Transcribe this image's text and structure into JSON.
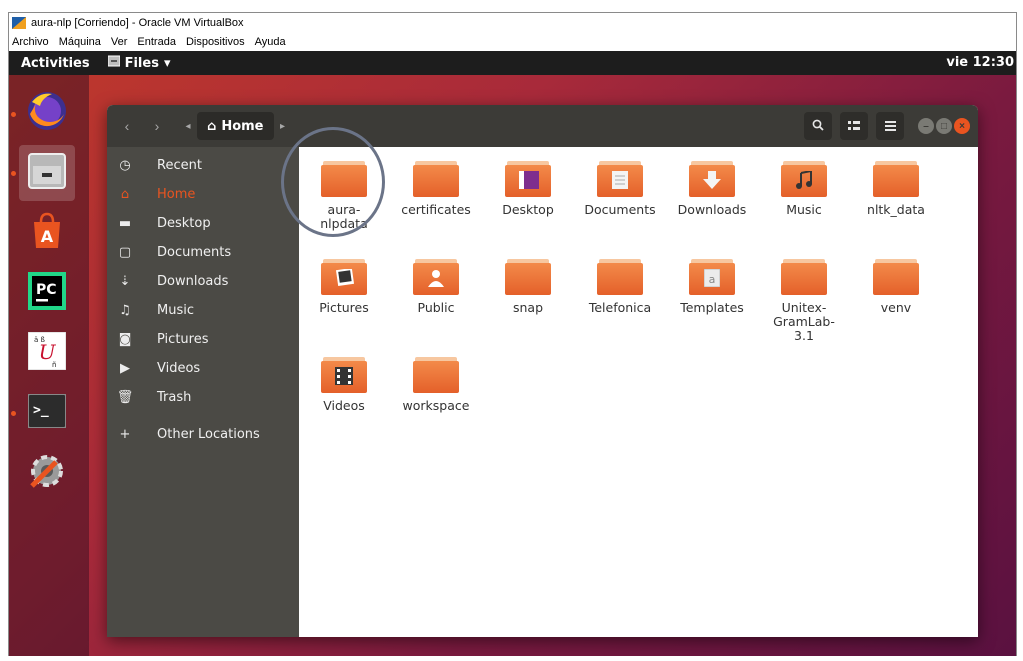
{
  "vbox": {
    "title": "aura-nlp [Corriendo] - Oracle VM VirtualBox",
    "menu": [
      "Archivo",
      "Máquina",
      "Ver",
      "Entrada",
      "Dispositivos",
      "Ayuda"
    ]
  },
  "topbar": {
    "activities": "Activities",
    "app_menu": "Files",
    "clock": "vie 12:30"
  },
  "dock": [
    "firefox-icon",
    "files-icon",
    "software-center-icon",
    "pycharm-icon",
    "unitex-icon",
    "terminal-icon",
    "settings-icon"
  ],
  "headerbar": {
    "path_home": "Home"
  },
  "sidebar": {
    "items": [
      {
        "icon": "clock-icon",
        "label": "Recent"
      },
      {
        "icon": "home-icon",
        "label": "Home"
      },
      {
        "icon": "folder-icon",
        "label": "Desktop"
      },
      {
        "icon": "document-icon",
        "label": "Documents"
      },
      {
        "icon": "download-icon",
        "label": "Downloads"
      },
      {
        "icon": "music-icon",
        "label": "Music"
      },
      {
        "icon": "camera-icon",
        "label": "Pictures"
      },
      {
        "icon": "video-icon",
        "label": "Videos"
      },
      {
        "icon": "trash-icon",
        "label": "Trash"
      },
      {
        "icon": "plus-icon",
        "label": "Other Locations"
      }
    ]
  },
  "files": [
    {
      "name": "aura-\nnlpdata",
      "l1": "aura-",
      "l2": "nlpdata",
      "emblem": ""
    },
    {
      "l1": "certificates",
      "emblem": ""
    },
    {
      "l1": "Desktop",
      "emblem": "desktop"
    },
    {
      "l1": "Documents",
      "emblem": "doc"
    },
    {
      "l1": "Downloads",
      "emblem": "down"
    },
    {
      "l1": "Music",
      "emblem": "music"
    },
    {
      "l1": "nltk_data",
      "emblem": ""
    },
    {
      "l1": "Pictures",
      "emblem": "pic"
    },
    {
      "l1": "Public",
      "emblem": "person"
    },
    {
      "l1": "snap",
      "emblem": ""
    },
    {
      "l1": "Telefonica",
      "emblem": ""
    },
    {
      "l1": "Templates",
      "emblem": "tpl"
    },
    {
      "l1": "Unitex-",
      "l2": "GramLab-",
      "l3": "3.1",
      "emblem": ""
    },
    {
      "l1": "venv",
      "emblem": ""
    },
    {
      "l1": "Videos",
      "emblem": "vid"
    },
    {
      "l1": "workspace",
      "emblem": ""
    }
  ]
}
